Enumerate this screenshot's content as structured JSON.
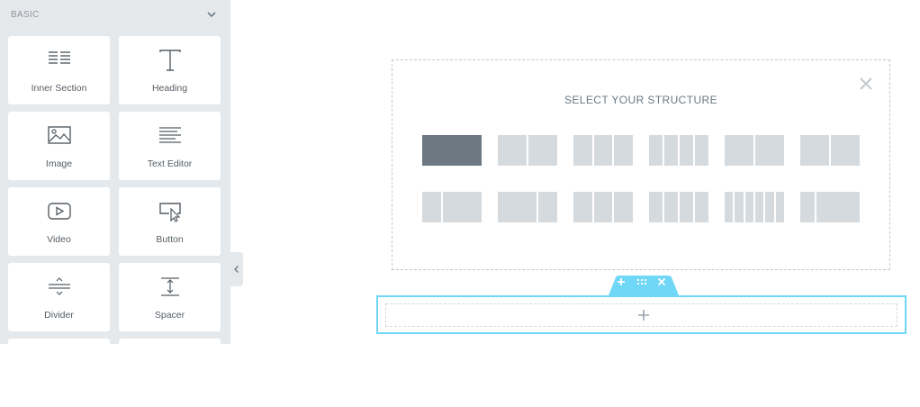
{
  "panel": {
    "category_title": "BASIC",
    "widgets": [
      {
        "label": "Inner Section",
        "icon": "inner-section-icon"
      },
      {
        "label": "Heading",
        "icon": "heading-icon"
      },
      {
        "label": "Image",
        "icon": "image-icon"
      },
      {
        "label": "Text Editor",
        "icon": "text-editor-icon"
      },
      {
        "label": "Video",
        "icon": "video-icon"
      },
      {
        "label": "Button",
        "icon": "button-icon"
      },
      {
        "label": "Divider",
        "icon": "divider-icon"
      },
      {
        "label": "Spacer",
        "icon": "spacer-icon"
      }
    ]
  },
  "structure": {
    "title": "SELECT YOUR STRUCTURE",
    "presets_row1": [
      [
        1
      ],
      [
        1,
        1
      ],
      [
        1,
        1,
        1
      ],
      [
        1,
        1,
        1,
        1
      ],
      [
        1,
        1
      ],
      [
        1,
        1
      ]
    ],
    "presets_row2": [
      [
        1,
        2
      ],
      [
        2,
        1
      ],
      [
        1,
        1,
        1
      ],
      [
        1,
        1,
        1,
        1
      ],
      [
        1,
        1,
        1,
        1,
        1,
        1
      ],
      [
        1,
        3
      ]
    ],
    "selected": 0
  },
  "colors": {
    "panel_bg": "#e6e9ec",
    "preset": "#d5dadf",
    "preset_selected": "#6d7882",
    "section_accent": "#71d7f7"
  }
}
